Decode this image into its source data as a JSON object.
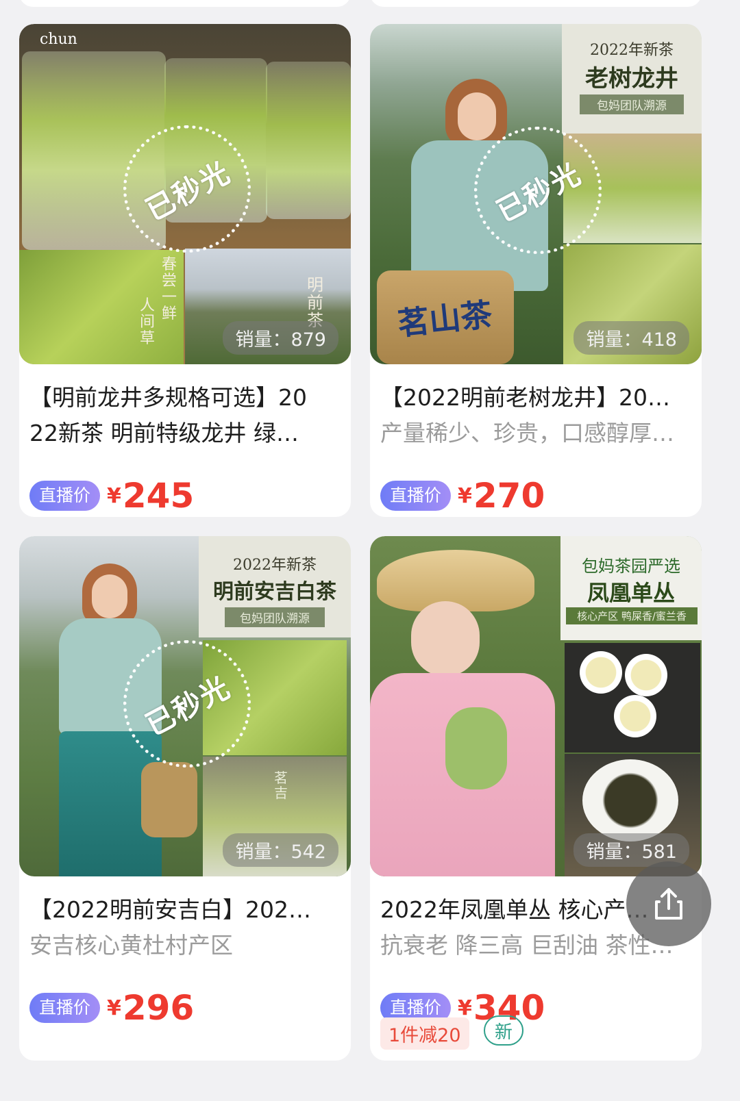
{
  "products": [
    {
      "title_line1": "【明前龙井多规格可选】20",
      "title_line2": "22新茶 明前特级龙井 绿…",
      "live_label": "直播价",
      "currency": "¥",
      "price": "245",
      "sales": "销量：879",
      "soldout": "已秒光",
      "image_text": {
        "logo": "chun",
        "vertical_left": "春尝一鲜",
        "vertical_left2": "人间草",
        "vertical_right": "明前茶"
      }
    },
    {
      "title_line1": "【2022明前老树龙井】20…",
      "title_line2": "产量稀少、珍贵，口感醇厚…",
      "live_label": "直播价",
      "currency": "¥",
      "price": "270",
      "sales": "销量：418",
      "soldout": "已秒光",
      "image_text": {
        "year": "2022年新茶",
        "name": "老树龙井",
        "badge": "包妈团队溯源",
        "basket": "茗山茶"
      }
    },
    {
      "title_line1": "【2022明前安吉白】202…",
      "title_line2": "安吉核心黄杜村产区",
      "live_label": "直播价",
      "currency": "¥",
      "price": "296",
      "sales": "销量：542",
      "soldout": "已秒光",
      "image_text": {
        "year": "2022年新茶",
        "name": "明前安吉白茶",
        "badge": "包妈团队溯源",
        "cup": "茗吉"
      }
    },
    {
      "title_line1": "2022年凤凰单丛 核心产…",
      "title_line2": "抗衰老 降三高 巨刮油 茶性…",
      "live_label": "直播价",
      "currency": "¥",
      "price": "340",
      "sales": "销量：581",
      "coupon": "1件减20",
      "new_tag": "新",
      "image_text": {
        "top": "包妈茶园严选",
        "name": "凤凰单丛",
        "badge": "核心产区  鸭屎香/蜜兰香"
      }
    }
  ],
  "colors": {
    "price": "#ee3a2f",
    "live_tag_start": "#6f7cf6",
    "live_tag_end": "#a38ef6",
    "new_tag": "#2fa08a"
  },
  "icons": {
    "share": "share-icon"
  }
}
